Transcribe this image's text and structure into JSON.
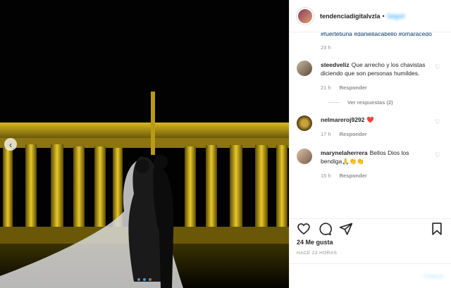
{
  "header": {
    "username": "tendenciadigitalvzla",
    "separator": "•",
    "follow_label": "Seguir"
  },
  "caption_tail": {
    "hashtags": "#fuertetiuna #daniellacabello #omaracedo",
    "time": "23 h"
  },
  "comments": [
    {
      "username": "steedveliz",
      "text": "Que arrecho y los chavistas diciendo que son personas humildes.",
      "time": "21 h",
      "reply_label": "Responder",
      "view_replies": "Ver respuestas (2)"
    },
    {
      "username": "nelmareroj9292",
      "text": "❤️",
      "time": "17 h",
      "reply_label": "Responder"
    },
    {
      "username": "marynelaherrera",
      "text": "Bellos Dios los bendiga🙏👏👏",
      "time": "15 h",
      "reply_label": "Responder"
    }
  ],
  "likes": "24 Me gusta",
  "posted_ago": "HACE 23 HORAS",
  "publish_label": "Publicar",
  "carousel": {
    "count": 3,
    "active_index": 1
  }
}
